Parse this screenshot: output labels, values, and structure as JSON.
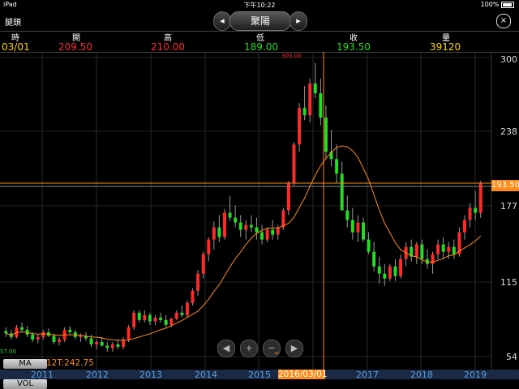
{
  "status": {
    "device": "iPad",
    "time": "下午10:22",
    "battery": "100%"
  },
  "nav": {
    "back_label": "腿頭",
    "title": "聚陽",
    "prev_icon": "◀",
    "next_icon": "▶",
    "close_icon": "×"
  },
  "header": {
    "labels": {
      "date": "時",
      "open": "開",
      "high": "高",
      "low": "低",
      "close": "收",
      "volume": "量"
    },
    "values": {
      "date": "03/01",
      "open": "209.50",
      "high": "210.00",
      "low": "189.00",
      "close": "193.50",
      "volume": "39120"
    },
    "colors": {
      "date": "#ffd400",
      "open": "#ff2a2a",
      "high": "#ff2a2a",
      "low": "#22dd22",
      "close": "#22dd22",
      "volume": "#ffd400"
    }
  },
  "chart_data": {
    "type": "candlestick",
    "y_ticks": [
      "300",
      "238",
      "177",
      "115",
      "54"
    ],
    "ylim": [
      54,
      300
    ],
    "x_ticks": [
      "2011",
      "2012",
      "2013",
      "2014",
      "2015",
      "2016/03/01",
      "2017",
      "2018",
      "2019"
    ],
    "selected_x": "2016/03/01",
    "current_price_label": "193.50",
    "max_label": "300.00",
    "min_label": "57.00",
    "up_color": "#ff2a2a",
    "down_color": "#22dd22",
    "ma_color": "#ff8c1a",
    "candles": [
      [
        75,
        78,
        70,
        73
      ],
      [
        73,
        76,
        68,
        70
      ],
      [
        70,
        80,
        69,
        78
      ],
      [
        78,
        82,
        74,
        76
      ],
      [
        76,
        79,
        70,
        72
      ],
      [
        72,
        74,
        66,
        68
      ],
      [
        68,
        72,
        65,
        70
      ],
      [
        70,
        76,
        68,
        74
      ],
      [
        74,
        77,
        70,
        71
      ],
      [
        71,
        73,
        64,
        66
      ],
      [
        66,
        70,
        63,
        68
      ],
      [
        68,
        78,
        66,
        76
      ],
      [
        76,
        79,
        72,
        74
      ],
      [
        74,
        76,
        68,
        70
      ],
      [
        70,
        73,
        66,
        71
      ],
      [
        71,
        74,
        67,
        69
      ],
      [
        69,
        72,
        62,
        64
      ],
      [
        64,
        68,
        60,
        66
      ],
      [
        66,
        70,
        62,
        63
      ],
      [
        63,
        66,
        58,
        61
      ],
      [
        61,
        66,
        58,
        64
      ],
      [
        64,
        68,
        60,
        62
      ],
      [
        62,
        70,
        60,
        68
      ],
      [
        68,
        80,
        66,
        78
      ],
      [
        78,
        92,
        76,
        90
      ],
      [
        90,
        92,
        82,
        84
      ],
      [
        84,
        92,
        82,
        88
      ],
      [
        88,
        90,
        80,
        83
      ],
      [
        83,
        88,
        80,
        86
      ],
      [
        86,
        90,
        82,
        84
      ],
      [
        84,
        88,
        78,
        80
      ],
      [
        80,
        86,
        78,
        85
      ],
      [
        85,
        92,
        84,
        90
      ],
      [
        90,
        96,
        86,
        88
      ],
      [
        88,
        100,
        86,
        98
      ],
      [
        98,
        110,
        96,
        108
      ],
      [
        108,
        125,
        104,
        122
      ],
      [
        122,
        140,
        118,
        138
      ],
      [
        138,
        152,
        132,
        150
      ],
      [
        150,
        165,
        142,
        160
      ],
      [
        160,
        170,
        148,
        152
      ],
      [
        152,
        175,
        150,
        172
      ],
      [
        172,
        186,
        165,
        168
      ],
      [
        168,
        178,
        160,
        164
      ],
      [
        164,
        170,
        152,
        158
      ],
      [
        158,
        166,
        150,
        162
      ],
      [
        162,
        170,
        156,
        160
      ],
      [
        160,
        168,
        150,
        156
      ],
      [
        156,
        162,
        146,
        150
      ],
      [
        150,
        160,
        148,
        158
      ],
      [
        158,
        166,
        150,
        154
      ],
      [
        154,
        162,
        150,
        160
      ],
      [
        160,
        176,
        158,
        174
      ],
      [
        174,
        198,
        170,
        196
      ],
      [
        196,
        230,
        194,
        228
      ],
      [
        228,
        262,
        222,
        258
      ],
      [
        258,
        276,
        248,
        252
      ],
      [
        252,
        282,
        246,
        278
      ],
      [
        278,
        295,
        266,
        270
      ],
      [
        270,
        282,
        244,
        250
      ],
      [
        250,
        260,
        216,
        222
      ],
      [
        222,
        240,
        210,
        216
      ],
      [
        216,
        228,
        196,
        204
      ],
      [
        204,
        214,
        182,
        174
      ],
      [
        174,
        186,
        160,
        166
      ],
      [
        166,
        176,
        150,
        156
      ],
      [
        156,
        170,
        148,
        164
      ],
      [
        164,
        168,
        148,
        150
      ],
      [
        150,
        156,
        138,
        140
      ],
      [
        140,
        148,
        124,
        128
      ],
      [
        128,
        136,
        114,
        122
      ],
      [
        122,
        130,
        112,
        118
      ],
      [
        118,
        130,
        116,
        128
      ],
      [
        128,
        134,
        116,
        120
      ],
      [
        120,
        138,
        118,
        134
      ],
      [
        134,
        148,
        128,
        144
      ],
      [
        144,
        150,
        132,
        136
      ],
      [
        136,
        148,
        130,
        146
      ],
      [
        146,
        150,
        130,
        134
      ],
      [
        134,
        142,
        126,
        130
      ],
      [
        130,
        140,
        122,
        138
      ],
      [
        138,
        150,
        134,
        146
      ],
      [
        146,
        152,
        134,
        140
      ],
      [
        140,
        148,
        134,
        144
      ],
      [
        144,
        150,
        134,
        138
      ],
      [
        138,
        160,
        136,
        156
      ],
      [
        156,
        170,
        150,
        166
      ],
      [
        166,
        180,
        160,
        176
      ],
      [
        176,
        190,
        166,
        172
      ],
      [
        172,
        198,
        168,
        196
      ]
    ]
  },
  "footer": {
    "ma_button": "MA",
    "ma_text": "12T:242.75",
    "vol_button": "VOL"
  },
  "controls": {
    "left_icon": "◀",
    "plus_icon": "+",
    "minus_icon": "−",
    "right_icon": "▶",
    "caret_icon": "^"
  }
}
